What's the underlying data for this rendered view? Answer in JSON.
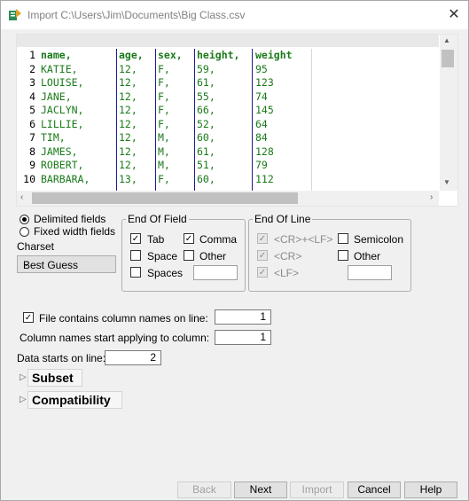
{
  "window": {
    "title": "Import C:\\Users\\Jim\\Documents\\Big Class.csv"
  },
  "preview": {
    "line_numbers": [
      "1",
      "2",
      "3",
      "4",
      "5",
      "6",
      "7",
      "8",
      "9",
      "10"
    ],
    "columns": [
      [
        "name,",
        "KATIE,",
        "LOUISE,",
        "JANE,",
        "JACLYN,",
        "LILLIE,",
        "TIM,",
        "JAMES,",
        "ROBERT,",
        "BARBARA,"
      ],
      [
        "age,",
        "12,",
        "12,",
        "12,",
        "12,",
        "12,",
        "12,",
        "12,",
        "12,",
        "13,"
      ],
      [
        "sex,",
        "F,",
        "F,",
        "F,",
        "F,",
        "F,",
        "M,",
        "M,",
        "M,",
        "F,"
      ],
      [
        "height,",
        "59,",
        "61,",
        "55,",
        "66,",
        "52,",
        "60,",
        "61,",
        "51,",
        "60,"
      ],
      [
        "weight",
        "95",
        "123",
        "74",
        "145",
        "64",
        "84",
        "128",
        "79",
        "112"
      ]
    ]
  },
  "format": {
    "delimited_label": "Delimited fields",
    "fixed_label": "Fixed width fields",
    "selected": "Delimited fields",
    "charset_label": "Charset",
    "charset_value": "Best Guess"
  },
  "end_of_field": {
    "title": "End Of Field",
    "tab": {
      "label": "Tab",
      "checked": true
    },
    "comma": {
      "label": "Comma",
      "checked": true
    },
    "space": {
      "label": "Space",
      "checked": false
    },
    "other": {
      "label": "Other",
      "checked": false
    },
    "spaces": {
      "label": "Spaces",
      "checked": false
    }
  },
  "end_of_line": {
    "title": "End Of Line",
    "crlf": {
      "label": "<CR>+<LF>",
      "checked": true
    },
    "cr": {
      "label": "<CR>",
      "checked": true
    },
    "lf": {
      "label": "<LF>",
      "checked": true
    },
    "semicolon": {
      "label": "Semicolon",
      "checked": false
    },
    "other": {
      "label": "Other",
      "checked": false
    }
  },
  "options": {
    "column_names_label": "File contains column names on line:",
    "column_names_checked": true,
    "column_names_line": "1",
    "start_col_label": "Column names start applying to column:",
    "start_col_value": "1",
    "data_starts_label": "Data starts on line:",
    "data_starts_value": "2"
  },
  "sections": {
    "subset": "Subset",
    "compatibility": "Compatibility"
  },
  "buttons": {
    "back": "Back",
    "next": "Next",
    "import": "Import",
    "cancel": "Cancel",
    "help": "Help"
  },
  "colors": {
    "preview_text": "#1a7a1a",
    "separator": "#1c1c8c"
  }
}
